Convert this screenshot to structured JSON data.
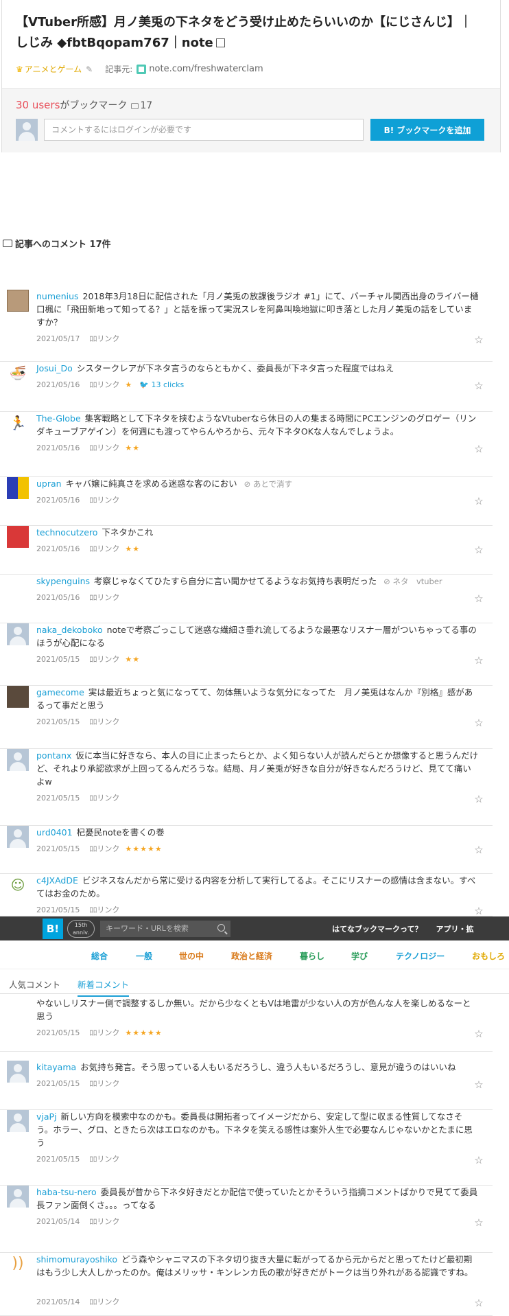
{
  "entry": {
    "title": "【VTuber所感】月ノ美兎の下ネタをどう受け止めたらいいのか【にじさんじ】｜しじみ ◆fbtBqopam767｜note",
    "category": "アニメとゲーム",
    "source_label": "記事元:",
    "source": "note.com/freshwaterclam"
  },
  "bookmark": {
    "users_count": "30 users",
    "users_suffix": "がブックマーク",
    "comment_count": "17",
    "input_placeholder": "コメントするにはログインが必要です",
    "button_label": "B! ブックマークを追加"
  },
  "section_title": "記事へのコメント 17件",
  "link_label": "ﾛﾛリンク",
  "comments": [
    {
      "user": "numenius",
      "text": "2018年3月18日に配信された「月ノ美兎の放課後ラジオ #1」にて、バーチャル関西出身のライバー樋口楓に「飛田新地って知ってる？」と話を振って実況スレを阿鼻叫喚地獄に叩き落とした月ノ美兎の話をしていますか？",
      "date": "2021/05/17",
      "stars": "",
      "extra": "",
      "tag": ""
    },
    {
      "user": "Josui_Do",
      "text": "シスタークレアが下ネタ言うのならともかく、委員長が下ネタ言った程度ではねえ",
      "date": "2021/05/16",
      "stars": "★",
      "extra": "13 clicks",
      "tag": ""
    },
    {
      "user": "The-Globe",
      "text": "集客戦略として下ネタを挟むようなVtuberなら休日の人の集まる時間にPCエンジンのグロゲー（リンダキューブアゲイン）を何週にも渡ってやらんやろから、元々下ネタOKな人なんでしょうよ。",
      "date": "2021/05/16",
      "stars": "★★",
      "extra": "",
      "tag": ""
    },
    {
      "user": "upran",
      "text": "キャバ嬢に純真さを求める迷惑な客のにおい",
      "date": "2021/05/16",
      "stars": "",
      "extra": "",
      "tag": "あとで消す"
    },
    {
      "user": "technocutzero",
      "text": "下ネタかこれ",
      "date": "2021/05/16",
      "stars": "★★",
      "extra": "",
      "tag": ""
    },
    {
      "user": "skypenguins",
      "text": "考察じゃなくてひたすら自分に言い聞かせてるようなお気持ち表明だった",
      "date": "2021/05/16",
      "stars": "",
      "extra": "",
      "tag": "ネタ　vtuber"
    },
    {
      "user": "naka_dekoboko",
      "text": "noteで考察ごっこして迷惑な繊細さ垂れ流してるような最悪なリスナー層がついちゃってる事のほうが心配になる",
      "date": "2021/05/15",
      "stars": "★★",
      "extra": "",
      "tag": ""
    },
    {
      "user": "gamecome",
      "text": "実は最近ちょっと気になってて、勿体無いような気分になってた　月ノ美兎はなんか『別格』感があるって事だと思う",
      "date": "2021/05/15",
      "stars": "",
      "extra": "",
      "tag": ""
    },
    {
      "user": "pontanx",
      "text": "仮に本当に好きなら、本人の目に止まったらとか、よく知らない人が読んだらとか想像すると思うんだけど、それより承認欲求が上回ってるんだろうな。結局、月ノ美兎が好きな自分が好きなんだろうけど、見てて痛いよw",
      "date": "2021/05/15",
      "stars": "",
      "extra": "",
      "tag": ""
    },
    {
      "user": "urd0401",
      "text": "杞憂民noteを書くの巻",
      "date": "2021/05/15",
      "stars": "★★★★★",
      "extra": "",
      "tag": ""
    },
    {
      "user": "c4JXAdDE",
      "text": "ビジネスなんだから常に受ける内容を分析して実行してるよ。そこにリスナーの感情は含まない。すべてはお金のため。",
      "date": "2021/05/15",
      "stars": "",
      "extra": "",
      "tag": ""
    }
  ],
  "cut_comment": {
    "text": "やないしリスナー側で調整するしか無い。だから少なくともVは地雷が少ない人の方が色んな人を楽しめるなーと思う",
    "date": "2021/05/15",
    "stars": "★★★★★"
  },
  "comments2": [
    {
      "user": "kitayama",
      "text": "お気持ち発言。そう思っている人もいるだろうし、違う人もいるだろうし、意見が違うのはいいね",
      "date": "2021/05/15"
    },
    {
      "user": "vjaPj",
      "text": "新しい方向を模索中なのかも。委員長は開拓者ってイメージだから、安定して型に収まる性質してなさそう。ホラー、グロ、ときたら次はエロなのかも。下ネタを笑える感性は案外人生で必要なんじゃないかとたまに思う",
      "date": "2021/05/15"
    },
    {
      "user": "haba-tsu-nero",
      "text": "委員長が昔から下ネタ好きだとか配信で使っていたとかそういう指摘コメントばかりで見てて委員長ファン面倒くさ。。。ってなる",
      "date": "2021/05/14"
    },
    {
      "user": "shimomurayoshiko",
      "text": "どう森やシャニマスの下ネタ切り抜き大量に転がってるから元からだと思ってたけど最初期はもう少し大人しかったのか。俺はメリッサ・キンレンカ氏の歌が好きだがトークは当り外れがある認識ですね。",
      "date": "2021/05/14"
    }
  ],
  "navbar": {
    "logo": "B!",
    "anniv_top": "15th",
    "anniv_bottom": "anniv.",
    "search_placeholder": "キーワード・URLを検索",
    "about": "はてなブックマークって？",
    "apps": "アプリ・拡"
  },
  "categories": [
    {
      "label": "総合",
      "color": "#1a9fd5"
    },
    {
      "label": "一般",
      "color": "#1a9fd5"
    },
    {
      "label": "世の中",
      "color": "#d97a1a"
    },
    {
      "label": "政治と経済",
      "color": "#d97a1a"
    },
    {
      "label": "暮らし",
      "color": "#2a9d5a"
    },
    {
      "label": "学び",
      "color": "#2a9d5a"
    },
    {
      "label": "テクノロジー",
      "color": "#1a9fd5"
    },
    {
      "label": "おもしろ",
      "color": "#e0a800"
    }
  ],
  "tabs": {
    "popular": "人気コメント",
    "new": "新着コメント"
  }
}
